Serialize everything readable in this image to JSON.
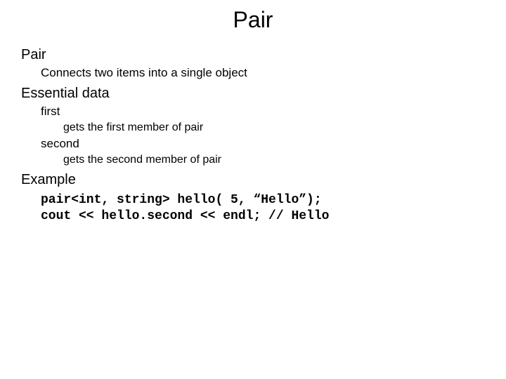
{
  "title": "Pair",
  "sections": {
    "pair_heading": "Pair",
    "pair_desc": "Connects two items into a single object",
    "essential_heading": "Essential data",
    "first_label": "first",
    "first_desc": "gets the first member of pair",
    "second_label": "second",
    "second_desc": "gets the second member of pair",
    "example_heading": "Example",
    "code_line1": "pair<int, string> hello( 5, “Hello”);",
    "code_line2": "cout << hello.second << endl; // Hello"
  }
}
